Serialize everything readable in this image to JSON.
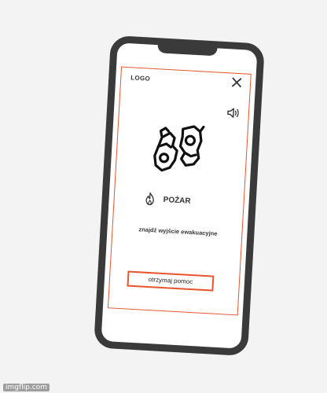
{
  "app": {
    "logo_text": "LOGO",
    "alert_title": "POŻAR",
    "instruction": "znajdź wyjście ewakuacyjne",
    "help_button_label": "otrzymaj pomoc"
  },
  "icons": {
    "close": "close-icon",
    "sound": "speaker-icon",
    "sign": "sign-language-icon",
    "alert": "fire-icon"
  },
  "colors": {
    "accent": "#e8542e",
    "phone_frame": "#3a3a3a",
    "text": "#333333"
  },
  "watermark": {
    "text": "imgflip.com"
  }
}
